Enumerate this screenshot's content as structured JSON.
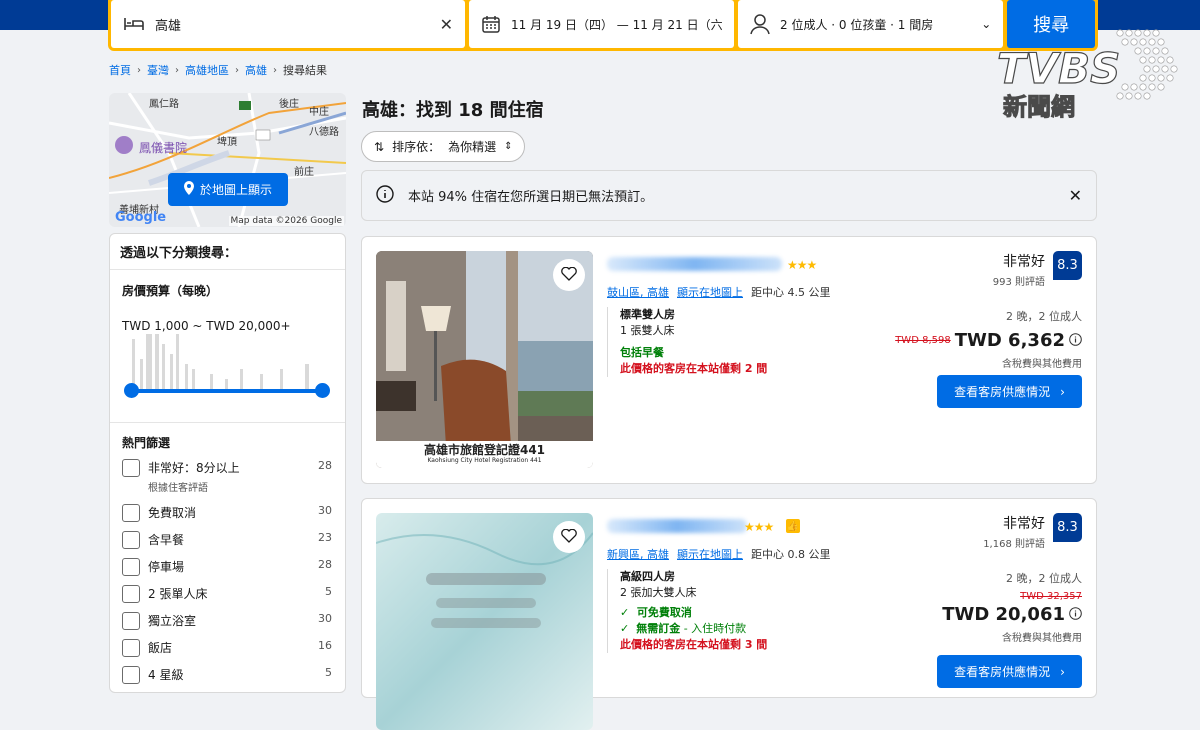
{
  "search": {
    "destination": "高雄",
    "dates": "11 月 19 日（四） — 11 月 21 日（六",
    "occupancy": "2 位成人 · 0 位孩童 · 1 間房",
    "button": "搜尋"
  },
  "breadcrumb": [
    "首頁",
    "臺灣",
    "高雄地區",
    "高雄",
    "搜尋結果"
  ],
  "map": {
    "labels": [
      "鳳仁路",
      "後庄",
      "中庄",
      "八德路",
      "埤頂",
      "鳳儀書院",
      "前庄",
      "善埔新村"
    ],
    "button": "於地圖上顯示",
    "credit": "Map data ©2026 Google",
    "google": "Google"
  },
  "filters": {
    "title": "透過以下分類搜尋：",
    "budget_title": "房價預算（每晚）",
    "budget_range": "TWD 1,000 ~ TWD 20,000+",
    "popular_title": "熱門篩選",
    "items": [
      {
        "label": "非常好：8分以上",
        "sub": "根據住客評語",
        "count": "28"
      },
      {
        "label": "免費取消",
        "count": "30"
      },
      {
        "label": "含早餐",
        "count": "23"
      },
      {
        "label": "停車場",
        "count": "28"
      },
      {
        "label": "2 張單人床",
        "count": "5"
      },
      {
        "label": "獨立浴室",
        "count": "30"
      },
      {
        "label": "飯店",
        "count": "16"
      },
      {
        "label": "4 星級",
        "count": "5"
      }
    ]
  },
  "results": {
    "title": "高雄：找到 18 間住宿",
    "sort_label": "排序依：",
    "sort_value": "為你精選",
    "notice": "本站 94% 住宿在您所選日期已無法預訂。"
  },
  "cards": [
    {
      "stars": "★★★",
      "district": "鼓山區, 高雄",
      "map_link": "顯示在地圖上",
      "distance": "距中心 4.5 公里",
      "room": "標準雙人房",
      "bed": "1 張雙人床",
      "perk1": "包括早餐",
      "scarcity": "此價格的客房在本站僅剩 2 間",
      "rating_word": "非常好",
      "reviews": "993 則評語",
      "score": "8.3",
      "nights": "2 晚，2 位成人",
      "old_price": "TWD 8,598",
      "price": "TWD 6,362",
      "tax": "含稅費與其他費用",
      "cta": "查看客房供應情況",
      "img_text1": "高雄市旅館登記證441",
      "img_text2": "Kaohsiung City Hotel Registration 441"
    },
    {
      "stars": "★★★",
      "district": "新興區, 高雄",
      "map_link": "顯示在地圖上",
      "distance": "距中心 0.8 公里",
      "room": "高級四人房",
      "bed": "2 張加大雙人床",
      "perk1": "可免費取消",
      "perk2": "無需訂金",
      "perk2_sub": " - 入住時付款",
      "scarcity": "此價格的客房在本站僅剩 3 間",
      "rating_word": "非常好",
      "reviews": "1,168 則評語",
      "score": "8.3",
      "nights": "2 晚，2 位成人",
      "old_price": "TWD 32,357",
      "price": "TWD 20,061",
      "tax": "含稅費與其他費用",
      "cta": "查看客房供應情況"
    }
  ],
  "watermark": {
    "brand": "TVBS",
    "sub": "新聞網"
  },
  "colors": {
    "accent": "#006ce4",
    "brand_dark": "#003b95",
    "search_border": "#ffb700",
    "star": "#febb02",
    "green": "#008009",
    "red": "#d4111e"
  }
}
